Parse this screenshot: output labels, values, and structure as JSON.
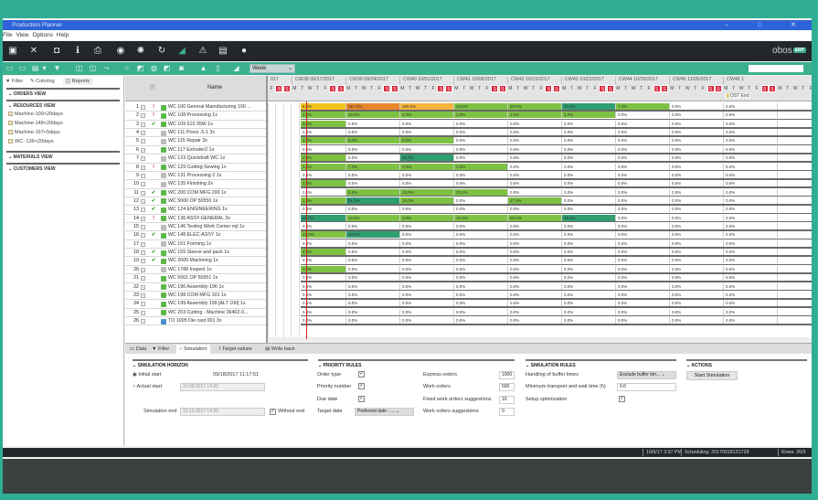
{
  "window": {
    "title": "Production Planner",
    "minimize": "–",
    "maximize": "□",
    "close": "✕"
  },
  "menu": [
    "File",
    "View",
    "Options",
    "Help"
  ],
  "logo": "obos",
  "logo_badge": "ERP",
  "dark_toolbar": [
    "save-icon",
    "close-icon",
    "window-icon",
    "info-icon",
    "print-icon",
    "globe-icon",
    "gear-icon",
    "refresh-icon",
    "chart-icon",
    "warning-icon",
    "inbox-icon",
    "user-icon"
  ],
  "dark_glyphs": [
    "▣",
    "✕",
    "◘",
    "ℹ",
    "⎙",
    "◉",
    "✺",
    "↻",
    "◢",
    "⚠",
    "▤",
    "●"
  ],
  "teal_glyphs": [
    "▭",
    "▭",
    "▤",
    "▾",
    "▼",
    "◫",
    "◫",
    "⤳",
    "○",
    "◩",
    "◍",
    "◩",
    "◙",
    "▲",
    "▯",
    "◢"
  ],
  "teal_toolbar": [
    "view1-icon",
    "view2-icon",
    "table-icon",
    "dropdown-icon",
    "filter-icon",
    "copy-icon",
    "duplicate-icon",
    "link-icon",
    "circle-icon",
    "edit-icon",
    "clock-icon",
    "move-icon",
    "split-icon",
    "alert-icon",
    "bar-icon",
    "chart-icon"
  ],
  "period_select": "Week",
  "left_panel": {
    "tabs": [
      "Filter",
      "Coloring",
      "Reports"
    ],
    "sections": {
      "orders": "ORDERS VIEW",
      "resources": "RESOURCES VIEW",
      "materials": "MATERIALS VIEW",
      "customers": "CUSTOMERS VIEW"
    },
    "resource_items": [
      "Machine-100<20days",
      "Machine-148<20days",
      "Machine-167<5days",
      "WC -136<20days"
    ]
  },
  "grid": {
    "col_status": "(!)",
    "col_name": "Name",
    "rows": [
      {
        "n": "1",
        "s": "!",
        "i": "g",
        "name": "WC 100 General Manufacturing 100 ..."
      },
      {
        "n": "2",
        "s": "!",
        "i": "g",
        "name": "WC 108 Processing 1x"
      },
      {
        "n": "3",
        "s": "✔",
        "i": "g",
        "name": "WC 109 610 35W 1x"
      },
      {
        "n": "4",
        "s": "",
        "i": "x",
        "name": "WC 111 Press .5-1 3x"
      },
      {
        "n": "5",
        "s": "",
        "i": "x",
        "name": "WC 115 Repair 3x"
      },
      {
        "n": "6",
        "s": "",
        "i": "g",
        "name": "WC 117 Extruder2 1x"
      },
      {
        "n": "7",
        "s": "",
        "i": "x",
        "name": "WC 123 Quickdraft WC 1x"
      },
      {
        "n": "8",
        "s": "!",
        "i": "g",
        "name": "WC 129 Cutting-Sewing 1x"
      },
      {
        "n": "9",
        "s": "",
        "i": "x",
        "name": "WC 131 Processing 2 1x"
      },
      {
        "n": "10",
        "s": "",
        "i": "x",
        "name": "WC 135 Finishing 2x"
      },
      {
        "n": "11",
        "s": "✔",
        "i": "g",
        "name": "WC 200 COM MFG 200 1x"
      },
      {
        "n": "12",
        "s": "✔",
        "i": "g",
        "name": "WC 5000 OP 50550 1x"
      },
      {
        "n": "13",
        "s": "✔",
        "i": "g",
        "name": "WC 124 ENGINEERING 1x"
      },
      {
        "n": "14",
        "s": "!",
        "i": "g",
        "name": "WC 136 ASSY-GENERAL 2x"
      },
      {
        "n": "15",
        "s": "",
        "i": "x",
        "name": "WC 146 Testing Work Center mjl 1x"
      },
      {
        "n": "16",
        "s": "✔",
        "i": "g",
        "name": "WC 148 ELEC-ASSY 1x"
      },
      {
        "n": "17",
        "s": "",
        "i": "x",
        "name": "WC 151 Forming 1x"
      },
      {
        "n": "18",
        "s": "✔",
        "i": "g",
        "name": "WC 155 Sleeve and pack 1x"
      },
      {
        "n": "19",
        "s": "✔",
        "i": "g",
        "name": "WC 2000 Machining 1x"
      },
      {
        "n": "20",
        "s": "",
        "i": "x",
        "name": "WC 1788 Inspect 1x"
      },
      {
        "n": "21",
        "s": "",
        "i": "g",
        "name": "WC 5001 OP 50551 1x"
      },
      {
        "n": "22",
        "s": "",
        "i": "g",
        "name": "WC 196 Assembly-196 1x"
      },
      {
        "n": "23",
        "s": "",
        "i": "g",
        "name": "WC 198 COM MFG 101 1x"
      },
      {
        "n": "24",
        "s": "",
        "i": "g",
        "name": "WC 199 Assembly 199 [ALT 100] 1x"
      },
      {
        "n": "25",
        "s": "",
        "i": "g",
        "name": "WC 203 Cutting - Machine 36402-0..."
      },
      {
        "n": "26",
        "s": "",
        "i": "t",
        "name": "TO 1005 Die cast 001 3x"
      }
    ]
  },
  "gantt": {
    "prev_week": "017",
    "weeks": [
      "CW38 09/17/2017",
      "CW39 09/24/2017",
      "CW40 10/01/2017",
      "CW41 10/08/2017",
      "CW42 10/15/2017",
      "CW43 10/22/2017",
      "CW44 10/29/2017",
      "CW45 11/05/2017",
      "CW46 1"
    ],
    "day_pattern": [
      "F",
      "S",
      "S",
      "M",
      "T",
      "W",
      "T"
    ],
    "marker": "DST End",
    "colors": {
      "y": "#f2c31d",
      "o": "#e8862c",
      "l": "#f5b43b",
      "g": "#7dc242",
      "t": "#2f9e70",
      "w": "#ffffff"
    },
    "rows": [
      [
        [
          "y",
          "8.0%"
        ],
        [
          "o",
          "157.0%"
        ],
        [
          "l",
          "100.0%"
        ],
        [
          "g",
          "23.0%"
        ],
        [
          "g",
          "29.0%"
        ],
        [
          "t",
          "47.0%"
        ],
        [
          "g",
          "7.0%"
        ],
        [
          "w",
          "0.0%"
        ],
        [
          "w",
          "0.0%"
        ]
      ],
      [
        [
          "g",
          "1.0%"
        ],
        [
          "g",
          "15.0%"
        ],
        [
          "g",
          "2.0%"
        ],
        [
          "g",
          "2.0%"
        ],
        [
          "g",
          "1.0%"
        ],
        [
          "g",
          "1.0%"
        ],
        [
          "w",
          "0.0%"
        ],
        [
          "w",
          "0.0%"
        ],
        [
          "w",
          "0.0%"
        ]
      ],
      [
        [
          "g",
          "3.0%"
        ],
        [
          "w",
          "0.0%"
        ],
        [
          "w",
          "0.0%"
        ],
        [
          "w",
          "0.0%"
        ],
        [
          "w",
          "0.0%"
        ],
        [
          "w",
          "0.0%"
        ],
        [
          "w",
          "0.0%"
        ],
        [
          "w",
          "0.0%"
        ],
        [
          "w",
          "0.0%"
        ]
      ],
      [
        [
          "w",
          "0.0%"
        ],
        [
          "w",
          "0.0%"
        ],
        [
          "w",
          "0.0%"
        ],
        [
          "w",
          "0.0%"
        ],
        [
          "w",
          "0.0%"
        ],
        [
          "w",
          "0.0%"
        ],
        [
          "w",
          "0.0%"
        ],
        [
          "w",
          "0.0%"
        ],
        [
          "w",
          "0.0%"
        ]
      ],
      [
        [
          "g",
          "1.0%"
        ],
        [
          "g",
          "8.0%"
        ],
        [
          "g",
          "5.0%"
        ],
        [
          "w",
          "0.0%"
        ],
        [
          "w",
          "0.0%"
        ],
        [
          "w",
          "0.0%"
        ],
        [
          "w",
          "0.0%"
        ],
        [
          "w",
          "0.0%"
        ],
        [
          "w",
          "0.0%"
        ]
      ],
      [
        [
          "w",
          "0.0%"
        ],
        [
          "w",
          "0.0%"
        ],
        [
          "w",
          "0.0%"
        ],
        [
          "w",
          "0.0%"
        ],
        [
          "w",
          "0.0%"
        ],
        [
          "w",
          "0.0%"
        ],
        [
          "w",
          "0.0%"
        ],
        [
          "w",
          "0.0%"
        ],
        [
          "w",
          "0.0%"
        ]
      ],
      [
        [
          "g",
          "2.0%"
        ],
        [
          "w",
          "0.0%"
        ],
        [
          "t",
          "36.0%"
        ],
        [
          "w",
          "0.0%"
        ],
        [
          "w",
          "0.0%"
        ],
        [
          "w",
          "0.0%"
        ],
        [
          "w",
          "0.0%"
        ],
        [
          "w",
          "0.0%"
        ],
        [
          "w",
          "0.0%"
        ]
      ],
      [
        [
          "g",
          "1.0%"
        ],
        [
          "g",
          "7.0%"
        ],
        [
          "g",
          "2.0%"
        ],
        [
          "g",
          "2.0%"
        ],
        [
          "w",
          "0.0%"
        ],
        [
          "w",
          "0.0%"
        ],
        [
          "w",
          "0.0%"
        ],
        [
          "w",
          "0.0%"
        ],
        [
          "w",
          "0.0%"
        ]
      ],
      [
        [
          "w",
          "0.0%"
        ],
        [
          "w",
          "0.0%"
        ],
        [
          "w",
          "0.0%"
        ],
        [
          "w",
          "0.0%"
        ],
        [
          "w",
          "0.0%"
        ],
        [
          "w",
          "0.0%"
        ],
        [
          "w",
          "0.0%"
        ],
        [
          "w",
          "0.0%"
        ],
        [
          "w",
          "0.0%"
        ]
      ],
      [
        [
          "g",
          "3.0%"
        ],
        [
          "w",
          "0.0%"
        ],
        [
          "w",
          "0.0%"
        ],
        [
          "w",
          "0.0%"
        ],
        [
          "w",
          "0.0%"
        ],
        [
          "w",
          "0.0%"
        ],
        [
          "w",
          "0.0%"
        ],
        [
          "w",
          "0.0%"
        ],
        [
          "w",
          "0.0%"
        ]
      ],
      [
        [
          "w",
          "0.0%"
        ],
        [
          "g",
          "5.0%"
        ],
        [
          "g",
          "23.0%"
        ],
        [
          "g",
          "23.0%"
        ],
        [
          "w",
          "0.0%"
        ],
        [
          "w",
          "0.0%"
        ],
        [
          "w",
          "0.0%"
        ],
        [
          "w",
          "0.0%"
        ],
        [
          "w",
          "0.0%"
        ]
      ],
      [
        [
          "g",
          "1.0%"
        ],
        [
          "t",
          "51.0%"
        ],
        [
          "g",
          "10.0%"
        ],
        [
          "w",
          "0.0%"
        ],
        [
          "g",
          "27.0%"
        ],
        [
          "w",
          "0.0%"
        ],
        [
          "w",
          "0.0%"
        ],
        [
          "w",
          "0.0%"
        ],
        [
          "w",
          "0.0%"
        ]
      ],
      [
        [
          "w",
          "0.0%"
        ],
        [
          "w",
          "0.0%"
        ],
        [
          "w",
          "0.0%"
        ],
        [
          "w",
          "0.0%"
        ],
        [
          "w",
          "0.0%"
        ],
        [
          "w",
          "0.0%"
        ],
        [
          "w",
          "0.0%"
        ],
        [
          "w",
          "0.0%"
        ],
        [
          "w",
          "0.0%"
        ]
      ],
      [
        [
          "t",
          "65.0%"
        ],
        [
          "g",
          "12.0%"
        ],
        [
          "g",
          "3.0%"
        ],
        [
          "g",
          "16.0%"
        ],
        [
          "g",
          "30.0%"
        ],
        [
          "t",
          "55.0%"
        ],
        [
          "w",
          "0.0%"
        ],
        [
          "w",
          "0.0%"
        ],
        [
          "w",
          "0.0%"
        ]
      ],
      [
        [
          "w",
          "0.0%"
        ],
        [
          "w",
          "0.0%"
        ],
        [
          "w",
          "0.0%"
        ],
        [
          "w",
          "0.0%"
        ],
        [
          "w",
          "0.0%"
        ],
        [
          "w",
          "0.0%"
        ],
        [
          "w",
          "0.0%"
        ],
        [
          "w",
          "0.0%"
        ],
        [
          "w",
          "0.0%"
        ]
      ],
      [
        [
          "g",
          "12.0%"
        ],
        [
          "t",
          "40.0%"
        ],
        [
          "w",
          "0.0%"
        ],
        [
          "w",
          "0.0%"
        ],
        [
          "w",
          "0.0%"
        ],
        [
          "w",
          "0.0%"
        ],
        [
          "w",
          "0.0%"
        ],
        [
          "w",
          "0.0%"
        ],
        [
          "w",
          "0.0%"
        ]
      ],
      [
        [
          "w",
          "0.0%"
        ],
        [
          "w",
          "0.0%"
        ],
        [
          "w",
          "0.0%"
        ],
        [
          "w",
          "0.0%"
        ],
        [
          "w",
          "0.0%"
        ],
        [
          "w",
          "0.0%"
        ],
        [
          "w",
          "0.0%"
        ],
        [
          "w",
          "0.0%"
        ],
        [
          "w",
          "0.0%"
        ]
      ],
      [
        [
          "g",
          "3.0%"
        ],
        [
          "w",
          "0.0%"
        ],
        [
          "w",
          "0.0%"
        ],
        [
          "w",
          "0.0%"
        ],
        [
          "w",
          "0.0%"
        ],
        [
          "w",
          "0.0%"
        ],
        [
          "w",
          "0.0%"
        ],
        [
          "w",
          "0.0%"
        ],
        [
          "w",
          "0.0%"
        ]
      ],
      [
        [
          "w",
          "0.0%"
        ],
        [
          "w",
          "0.0%"
        ],
        [
          "w",
          "0.0%"
        ],
        [
          "w",
          "0.0%"
        ],
        [
          "w",
          "0.0%"
        ],
        [
          "w",
          "0.0%"
        ],
        [
          "w",
          "0.0%"
        ],
        [
          "w",
          "0.0%"
        ],
        [
          "w",
          "0.0%"
        ]
      ],
      [
        [
          "g",
          "3.0%"
        ],
        [
          "w",
          "0.0%"
        ],
        [
          "w",
          "0.0%"
        ],
        [
          "w",
          "0.0%"
        ],
        [
          "w",
          "0.0%"
        ],
        [
          "w",
          "0.0%"
        ],
        [
          "w",
          "0.0%"
        ],
        [
          "w",
          "0.0%"
        ],
        [
          "w",
          "0.0%"
        ]
      ],
      [
        [
          "w",
          "0.0%"
        ],
        [
          "w",
          "0.0%"
        ],
        [
          "w",
          "0.0%"
        ],
        [
          "w",
          "0.0%"
        ],
        [
          "w",
          "0.0%"
        ],
        [
          "w",
          "0.0%"
        ],
        [
          "w",
          "0.0%"
        ],
        [
          "w",
          "0.0%"
        ],
        [
          "w",
          "0.0%"
        ]
      ],
      [
        [
          "w",
          "0.0%"
        ],
        [
          "w",
          "0.0%"
        ],
        [
          "w",
          "0.0%"
        ],
        [
          "w",
          "0.0%"
        ],
        [
          "w",
          "0.0%"
        ],
        [
          "w",
          "0.0%"
        ],
        [
          "w",
          "0.0%"
        ],
        [
          "w",
          "0.0%"
        ],
        [
          "w",
          "0.0%"
        ]
      ],
      [
        [
          "w",
          "0.0%"
        ],
        [
          "w",
          "0.0%"
        ],
        [
          "w",
          "0.0%"
        ],
        [
          "w",
          "0.0%"
        ],
        [
          "w",
          "0.0%"
        ],
        [
          "w",
          "0.0%"
        ],
        [
          "w",
          "0.0%"
        ],
        [
          "w",
          "0.0%"
        ],
        [
          "w",
          "0.0%"
        ]
      ],
      [
        [
          "w",
          "0.0%"
        ],
        [
          "w",
          "0.0%"
        ],
        [
          "w",
          "0.0%"
        ],
        [
          "w",
          "0.0%"
        ],
        [
          "w",
          "0.0%"
        ],
        [
          "w",
          "0.0%"
        ],
        [
          "w",
          "0.0%"
        ],
        [
          "w",
          "0.0%"
        ],
        [
          "w",
          "0.0%"
        ]
      ],
      [
        [
          "w",
          "0.0%"
        ],
        [
          "w",
          "0.0%"
        ],
        [
          "w",
          "0.0%"
        ],
        [
          "w",
          "0.0%"
        ],
        [
          "w",
          "0.0%"
        ],
        [
          "w",
          "0.0%"
        ],
        [
          "w",
          "0.0%"
        ],
        [
          "w",
          "0.0%"
        ],
        [
          "w",
          "0.0%"
        ]
      ],
      [
        [
          "w",
          "0.0%"
        ],
        [
          "w",
          "0.0%"
        ],
        [
          "w",
          "0.0%"
        ],
        [
          "w",
          "0.0%"
        ],
        [
          "w",
          "0.0%"
        ],
        [
          "w",
          "0.0%"
        ],
        [
          "w",
          "0.0%"
        ],
        [
          "w",
          "0.0%"
        ],
        [
          "w",
          "0.0%"
        ]
      ]
    ]
  },
  "bottom": {
    "tabs": [
      "Data",
      "Filter",
      "Simulation",
      "Target values",
      "Write back"
    ],
    "horizon": {
      "title": "SIMULATION HORIZON",
      "initial_start": "Initial start",
      "initial_value": "09/18/2017 11:17:51",
      "actual_start": "Actual start",
      "actual_value": "19.09.2017 14:20",
      "sim_end": "Simulation end",
      "sim_end_value": "19.10.2017 14:20",
      "without_end": "Without end"
    },
    "priority": {
      "title": "PRIORITY RULES",
      "order_type": "Order type",
      "priority_number": "Priority number",
      "due_date": "Due date",
      "target_date": "Target date",
      "target_value": "Preferred date - ...",
      "express": "Express orders",
      "express_v": "1000",
      "work": "Work orders",
      "work_v": "500",
      "fixed": "Fixed work orders suggestions",
      "fixed_v": "10",
      "sugg": "Work orders suggestions",
      "sugg_v": "0"
    },
    "rules": {
      "title": "SIMULATION RULES",
      "buffer": "Handling of buffer times",
      "buffer_v": "Exclude buffer tim...",
      "min_transport": "Minimum transport and wait time (h)",
      "min_transport_v": "0.0",
      "setup": "Setup optimization"
    },
    "actions": {
      "title": "ACTIONS",
      "start": "Start Simulation"
    }
  },
  "status": {
    "datetime": "10/5/17 3:37 PM",
    "scheduling": "Scheduling: 20170918131728",
    "rows": "Rows: 26/3"
  }
}
